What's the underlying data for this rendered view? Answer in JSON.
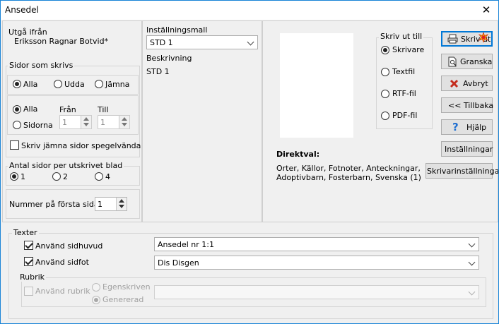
{
  "window": {
    "title": "Ansedel",
    "close_glyph": "✕"
  },
  "utga": {
    "label": "Utgå ifrån",
    "value": "Eriksson Ragnar Botvid*"
  },
  "sidor": {
    "label": "Sidor som skrivs",
    "which": [
      "Alla",
      "Udda",
      "Jämna"
    ],
    "which_selected": 0,
    "range_all": "Alla",
    "range_pages": "Sidorna",
    "from_label": "Från",
    "to_label": "Till",
    "from_value": "1",
    "to_value": "1",
    "mirror_label": "Skriv jämna sidor spegelvända"
  },
  "antal": {
    "label": "Antal sidor per utskrivet blad",
    "options": [
      "1",
      "2",
      "4"
    ],
    "selected": 0
  },
  "nummer": {
    "label": "Nummer på första sidan",
    "value": "1"
  },
  "mall": {
    "label": "Inställningsmall",
    "value": "STD 1",
    "desc_label": "Beskrivning",
    "desc_value": "STD 1"
  },
  "skriv_ut_till": {
    "label": "Skriv ut till",
    "options": [
      "Skrivare",
      "Textfil",
      "RTF-fil",
      "PDF-fil"
    ],
    "selected": 0
  },
  "direktval": {
    "label": "Direktval:",
    "line1": "Orter, Källor, Fotnoter, Anteckningar,",
    "line2": "Adoptivbarn, Fosterbarn, Svenska (1)"
  },
  "buttons": {
    "skriv_ut": "Skriv ut",
    "granska": "Granska",
    "avbryt": "Avbryt",
    "tillbaka": "<< Tillbaka",
    "hjalp": "Hjälp",
    "installningar": "Inställningar",
    "skrivarinstallningar": "Skrivarinställningar"
  },
  "texter": {
    "label": "Texter",
    "sidhuvud_label": "Använd sidhuvud",
    "sidhuvud_value": "Ansedel nr 1:1",
    "sidfot_label": "Använd sidfot",
    "sidfot_value": "Dis Disgen",
    "rubrik_label": "Rubrik",
    "anvand_rubrik": "Använd rubrik",
    "egenskriven": "Egenskriven",
    "genererad": "Genererad",
    "rubrik_value": ""
  },
  "colors": {
    "accent": "#0078d7",
    "avbryt_x": "#c42b1c",
    "help_q": "#1f6fd1"
  }
}
